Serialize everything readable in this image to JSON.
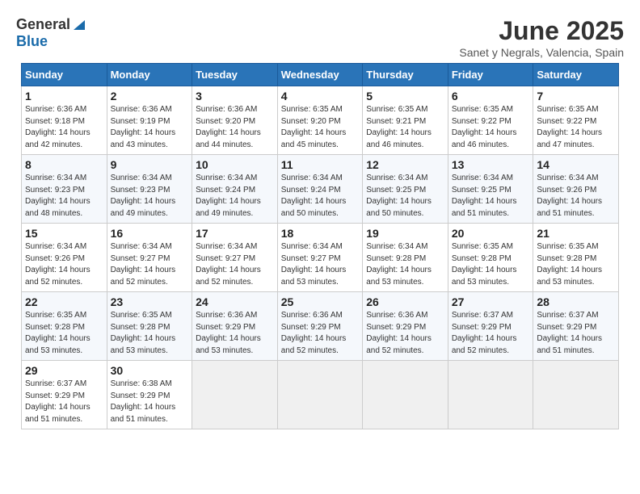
{
  "header": {
    "logo_general": "General",
    "logo_blue": "Blue",
    "title": "June 2025",
    "subtitle": "Sanet y Negrals, Valencia, Spain"
  },
  "calendar": {
    "weekdays": [
      "Sunday",
      "Monday",
      "Tuesday",
      "Wednesday",
      "Thursday",
      "Friday",
      "Saturday"
    ],
    "weeks": [
      [
        {
          "day": "",
          "info": ""
        },
        {
          "day": "2",
          "info": "Sunrise: 6:36 AM\nSunset: 9:19 PM\nDaylight: 14 hours\nand 43 minutes."
        },
        {
          "day": "3",
          "info": "Sunrise: 6:36 AM\nSunset: 9:20 PM\nDaylight: 14 hours\nand 44 minutes."
        },
        {
          "day": "4",
          "info": "Sunrise: 6:35 AM\nSunset: 9:20 PM\nDaylight: 14 hours\nand 45 minutes."
        },
        {
          "day": "5",
          "info": "Sunrise: 6:35 AM\nSunset: 9:21 PM\nDaylight: 14 hours\nand 46 minutes."
        },
        {
          "day": "6",
          "info": "Sunrise: 6:35 AM\nSunset: 9:22 PM\nDaylight: 14 hours\nand 46 minutes."
        },
        {
          "day": "7",
          "info": "Sunrise: 6:35 AM\nSunset: 9:22 PM\nDaylight: 14 hours\nand 47 minutes."
        }
      ],
      [
        {
          "day": "1",
          "info": "Sunrise: 6:36 AM\nSunset: 9:18 PM\nDaylight: 14 hours\nand 42 minutes."
        },
        {
          "day": "",
          "info": ""
        },
        {
          "day": "",
          "info": ""
        },
        {
          "day": "",
          "info": ""
        },
        {
          "day": "",
          "info": ""
        },
        {
          "day": "",
          "info": ""
        },
        {
          "day": "",
          "info": ""
        }
      ],
      [
        {
          "day": "8",
          "info": "Sunrise: 6:34 AM\nSunset: 9:23 PM\nDaylight: 14 hours\nand 48 minutes."
        },
        {
          "day": "9",
          "info": "Sunrise: 6:34 AM\nSunset: 9:23 PM\nDaylight: 14 hours\nand 49 minutes."
        },
        {
          "day": "10",
          "info": "Sunrise: 6:34 AM\nSunset: 9:24 PM\nDaylight: 14 hours\nand 49 minutes."
        },
        {
          "day": "11",
          "info": "Sunrise: 6:34 AM\nSunset: 9:24 PM\nDaylight: 14 hours\nand 50 minutes."
        },
        {
          "day": "12",
          "info": "Sunrise: 6:34 AM\nSunset: 9:25 PM\nDaylight: 14 hours\nand 50 minutes."
        },
        {
          "day": "13",
          "info": "Sunrise: 6:34 AM\nSunset: 9:25 PM\nDaylight: 14 hours\nand 51 minutes."
        },
        {
          "day": "14",
          "info": "Sunrise: 6:34 AM\nSunset: 9:26 PM\nDaylight: 14 hours\nand 51 minutes."
        }
      ],
      [
        {
          "day": "15",
          "info": "Sunrise: 6:34 AM\nSunset: 9:26 PM\nDaylight: 14 hours\nand 52 minutes."
        },
        {
          "day": "16",
          "info": "Sunrise: 6:34 AM\nSunset: 9:27 PM\nDaylight: 14 hours\nand 52 minutes."
        },
        {
          "day": "17",
          "info": "Sunrise: 6:34 AM\nSunset: 9:27 PM\nDaylight: 14 hours\nand 52 minutes."
        },
        {
          "day": "18",
          "info": "Sunrise: 6:34 AM\nSunset: 9:27 PM\nDaylight: 14 hours\nand 53 minutes."
        },
        {
          "day": "19",
          "info": "Sunrise: 6:34 AM\nSunset: 9:28 PM\nDaylight: 14 hours\nand 53 minutes."
        },
        {
          "day": "20",
          "info": "Sunrise: 6:35 AM\nSunset: 9:28 PM\nDaylight: 14 hours\nand 53 minutes."
        },
        {
          "day": "21",
          "info": "Sunrise: 6:35 AM\nSunset: 9:28 PM\nDaylight: 14 hours\nand 53 minutes."
        }
      ],
      [
        {
          "day": "22",
          "info": "Sunrise: 6:35 AM\nSunset: 9:28 PM\nDaylight: 14 hours\nand 53 minutes."
        },
        {
          "day": "23",
          "info": "Sunrise: 6:35 AM\nSunset: 9:28 PM\nDaylight: 14 hours\nand 53 minutes."
        },
        {
          "day": "24",
          "info": "Sunrise: 6:36 AM\nSunset: 9:29 PM\nDaylight: 14 hours\nand 53 minutes."
        },
        {
          "day": "25",
          "info": "Sunrise: 6:36 AM\nSunset: 9:29 PM\nDaylight: 14 hours\nand 52 minutes."
        },
        {
          "day": "26",
          "info": "Sunrise: 6:36 AM\nSunset: 9:29 PM\nDaylight: 14 hours\nand 52 minutes."
        },
        {
          "day": "27",
          "info": "Sunrise: 6:37 AM\nSunset: 9:29 PM\nDaylight: 14 hours\nand 52 minutes."
        },
        {
          "day": "28",
          "info": "Sunrise: 6:37 AM\nSunset: 9:29 PM\nDaylight: 14 hours\nand 51 minutes."
        }
      ],
      [
        {
          "day": "29",
          "info": "Sunrise: 6:37 AM\nSunset: 9:29 PM\nDaylight: 14 hours\nand 51 minutes."
        },
        {
          "day": "30",
          "info": "Sunrise: 6:38 AM\nSunset: 9:29 PM\nDaylight: 14 hours\nand 51 minutes."
        },
        {
          "day": "",
          "info": ""
        },
        {
          "day": "",
          "info": ""
        },
        {
          "day": "",
          "info": ""
        },
        {
          "day": "",
          "info": ""
        },
        {
          "day": "",
          "info": ""
        }
      ]
    ]
  }
}
